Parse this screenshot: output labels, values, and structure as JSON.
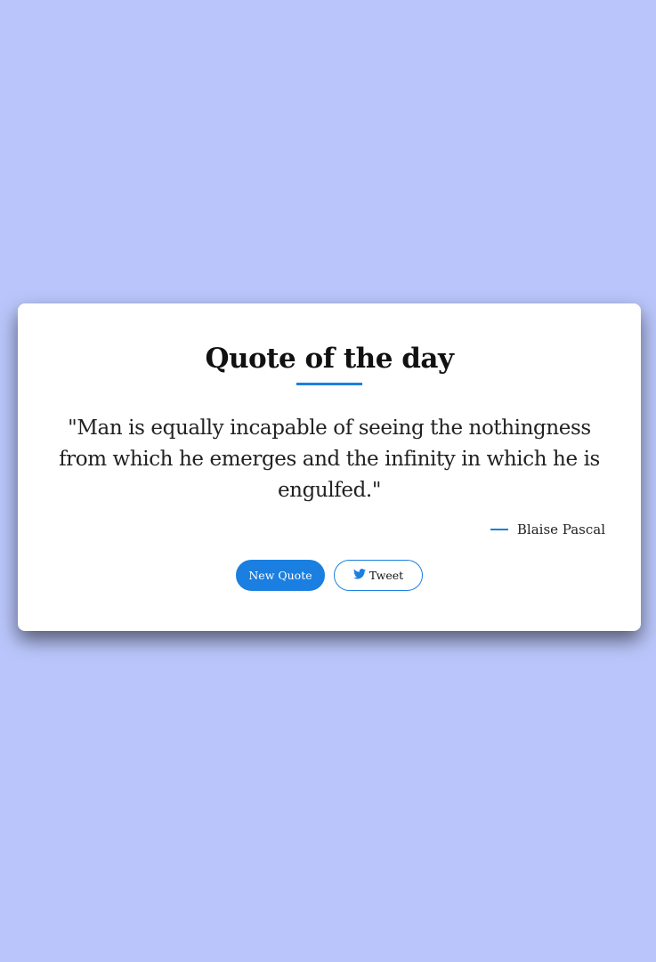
{
  "card": {
    "title": "Quote of the day",
    "quote": "\"Man is equally incapable of seeing the nothingness from which he emerges and the infinity in which he is engulfed.\"",
    "author": "Blaise Pascal"
  },
  "buttons": {
    "new_quote_label": "New Quote",
    "tweet_label": "Tweet",
    "tweet_icon": "twitter-bird-icon"
  },
  "colors": {
    "background": "#bac6fb",
    "accent": "#1a7fe0",
    "card": "#ffffff"
  }
}
